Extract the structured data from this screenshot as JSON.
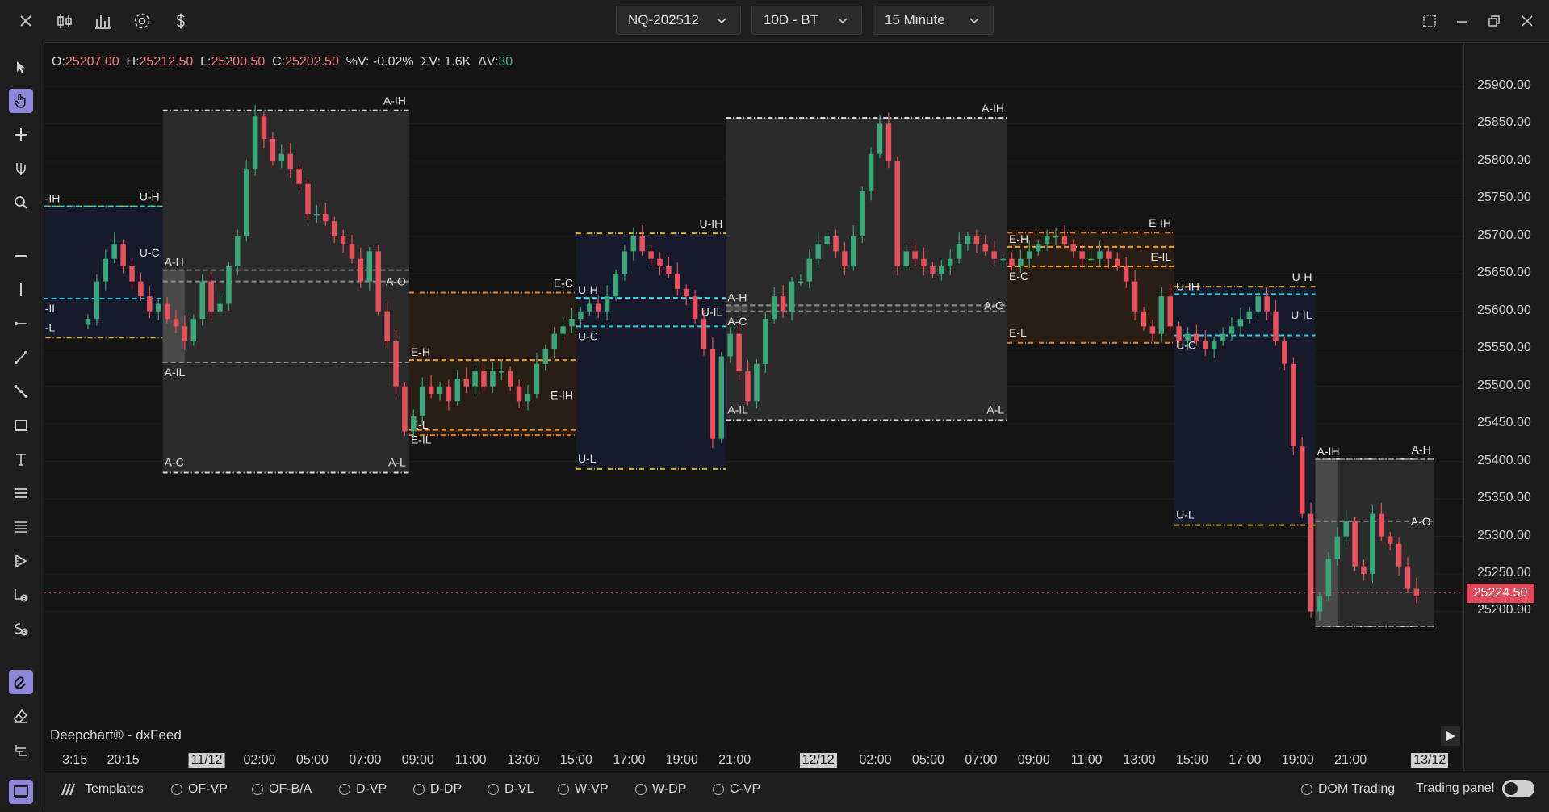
{
  "toolbar": {
    "symbol": "NQ-202512",
    "range": "10D - BT",
    "interval": "15 Minute",
    "icons": [
      "close-icon",
      "candlestick-icon",
      "bar-chart-icon",
      "settings-icon",
      "dollar-icon",
      "maximize-icon",
      "minimize-icon",
      "restore-icon",
      "window-close-icon"
    ]
  },
  "left_tools": [
    "cursor-arrow-icon",
    "hand-pointer-icon",
    "crosshair-icon",
    "fork-pointer-icon",
    "zoom-icon",
    "horizontal-line-icon",
    "vertical-line-icon",
    "ray-icon",
    "trend-line-icon",
    "path-icon",
    "rectangle-icon",
    "text-icon",
    "lines-icon",
    "multi-lines-icon",
    "ruler-icon",
    "price-buy-icon",
    "price-sell-icon",
    "magnet-icon",
    "eraser-icon",
    "layers-icon",
    "panel-icon"
  ],
  "ohlc": {
    "o_label": "O:",
    "o": "25207.00",
    "h_label": "H:",
    "h": "25212.50",
    "l_label": "L:",
    "l": "25200.50",
    "c_label": "C:",
    "c": "25202.50",
    "pv": "%V: -0.02%",
    "sv": "ΣV: 1.6K",
    "dv_label": "ΔV:",
    "dv": "30"
  },
  "watermark": "Deepchart® - dxFeed",
  "current_price": "25224.50",
  "bottom": {
    "templates": "Templates",
    "radios": [
      "OF-VP",
      "OF-B/A",
      "D-VP",
      "D-DP",
      "D-VL",
      "W-VP",
      "W-DP",
      "C-VP"
    ],
    "dom_trading": "DOM Trading",
    "trading_panel": "Trading panel"
  },
  "colors": {
    "up": "#3aa67b",
    "down": "#e8505b",
    "asia": "#d8d8d8",
    "europe": "#f4a020",
    "us": "#27d3e8",
    "session_y": "#d8b32e"
  },
  "chart_data": {
    "type": "candlestick",
    "ylim": [
      25180,
      25930
    ],
    "y_ticks": [
      25900,
      25850,
      25800,
      25750,
      25700,
      25650,
      25600,
      25550,
      25500,
      25450,
      25400,
      25350,
      25300,
      25250,
      25200
    ],
    "y_tick_labels": [
      "25900.00",
      "25850.00",
      "25800.00",
      "25750.00",
      "25700.00",
      "25650.00",
      "25600.00",
      "25550.00",
      "25500.00",
      "25450.00",
      "25400.00",
      "25350.00",
      "25300.00",
      "25250.00",
      "25200.00"
    ],
    "x_ticks": [
      {
        "label": "3:15",
        "xi": -1.5
      },
      {
        "label": "20:15",
        "xi": 4
      },
      {
        "label": "11/12",
        "xi": 13.5,
        "hl": true
      },
      {
        "label": "02:00",
        "xi": 19.5
      },
      {
        "label": "05:00",
        "xi": 25.5
      },
      {
        "label": "07:00",
        "xi": 31.5
      },
      {
        "label": "09:00",
        "xi": 37.5
      },
      {
        "label": "11:00",
        "xi": 43.5
      },
      {
        "label": "13:00",
        "xi": 49.5
      },
      {
        "label": "15:00",
        "xi": 55.5
      },
      {
        "label": "17:00",
        "xi": 61.5
      },
      {
        "label": "19:00",
        "xi": 67.5
      },
      {
        "label": "21:00",
        "xi": 73.5
      },
      {
        "label": "12/12",
        "xi": 83,
        "hl": true
      },
      {
        "label": "02:00",
        "xi": 89.5
      },
      {
        "label": "05:00",
        "xi": 95.5
      },
      {
        "label": "07:00",
        "xi": 101.5
      },
      {
        "label": "09:00",
        "xi": 107.5
      },
      {
        "label": "11:00",
        "xi": 113.5
      },
      {
        "label": "13:00",
        "xi": 119.5
      },
      {
        "label": "15:00",
        "xi": 125.5
      },
      {
        "label": "17:00",
        "xi": 131.5
      },
      {
        "label": "19:00",
        "xi": 137.5
      },
      {
        "label": "21:00",
        "xi": 143.5
      },
      {
        "label": "13/12",
        "xi": 152.5,
        "hl": true
      }
    ],
    "close": [
      25590,
      25640,
      25670,
      25690,
      25660,
      25640,
      25620,
      25600,
      25610,
      25590,
      25580,
      25560,
      25590,
      25640,
      25600,
      25610,
      25660,
      25700,
      25790,
      25860,
      25830,
      25800,
      25810,
      25790,
      25770,
      25730,
      25730,
      25720,
      25700,
      25690,
      25670,
      25640,
      25680,
      25600,
      25560,
      25500,
      25440,
      25460,
      25500,
      25490,
      25500,
      25480,
      25510,
      25500,
      25520,
      25500,
      25520,
      25520,
      25500,
      25480,
      25490,
      25530,
      25550,
      25570,
      25580,
      25590,
      25600,
      25610,
      25600,
      25620,
      25650,
      25680,
      25700,
      25680,
      25670,
      25660,
      25650,
      25630,
      25620,
      25590,
      25550,
      25430,
      25540,
      25570,
      25520,
      25480,
      25530,
      25590,
      25620,
      25600,
      25640,
      25640,
      25670,
      25690,
      25700,
      25680,
      25660,
      25700,
      25760,
      25810,
      25850,
      25800,
      25660,
      25680,
      25670,
      25660,
      25650,
      25660,
      25670,
      25690,
      25700,
      25690,
      25680,
      25670,
      25670,
      25660,
      25670,
      25680,
      25690,
      25700,
      25700,
      25690,
      25680,
      25670,
      25670,
      25680,
      25670,
      25660,
      25640,
      25600,
      25580,
      25570,
      25620,
      25580,
      25560,
      25570,
      25560,
      25550,
      25560,
      25570,
      25580,
      25590,
      25600,
      25620,
      25600,
      25560,
      25530,
      25420,
      25330,
      25200,
      25220,
      25270,
      25300,
      25320,
      25260,
      25250,
      25330,
      25300,
      25290,
      25260,
      25230,
      25220
    ],
    "sessions": [
      {
        "type": "US",
        "x0": -6,
        "x1": 8.5,
        "high": 25740,
        "low": 25565,
        "ih": 25740,
        "il": 25617,
        "labels": [
          "U-IH",
          "U-H",
          "U-C",
          "U-IL",
          "U-L"
        ]
      },
      {
        "type": "Asia",
        "x0": 8.5,
        "x1": 36.5,
        "high": 25868,
        "low": 25385,
        "ib_x1": 11,
        "ih": 25655,
        "il": 25532,
        "open": 25640,
        "labels": [
          "A-H",
          "A-IH",
          "A-O",
          "A-IL",
          "A-C",
          "A-L"
        ]
      },
      {
        "type": "Europe",
        "x0": 36.5,
        "x1": 55.5,
        "high": 25625,
        "low": 25435,
        "ih": 25535,
        "il": 25442,
        "labels": [
          "E-H",
          "E-C",
          "E-IH",
          "E-IL",
          "E-L"
        ]
      },
      {
        "type": "US",
        "x0": 55.5,
        "x1": 72.5,
        "high": 25704,
        "low": 25390,
        "ih": 25618,
        "il": 25580,
        "labels": [
          "U-H",
          "U-IH",
          "U-IL",
          "U-C",
          "U-L"
        ]
      },
      {
        "type": "Asia",
        "x0": 72.5,
        "x1": 104.5,
        "high": 25858,
        "low": 25455,
        "ib_x1": 75,
        "ih": 25608,
        "il": 25600,
        "open": 25608,
        "labels": [
          "A-H",
          "A-IH",
          "A-O",
          "A-C",
          "A-IL",
          "A-L"
        ]
      },
      {
        "type": "Europe",
        "x0": 104.5,
        "x1": 123.5,
        "high": 25705,
        "low": 25558,
        "ih": 25686,
        "il": 25660,
        "labels": [
          "E-H",
          "E-IH",
          "E-IL",
          "E-C",
          "E-L"
        ]
      },
      {
        "type": "US",
        "x0": 123.5,
        "x1": 139.5,
        "high": 25633,
        "low": 25315,
        "ih": 25623,
        "il": 25568,
        "labels": [
          "U-IH",
          "U-H",
          "U-IL",
          "U-C",
          "U-L"
        ]
      },
      {
        "type": "Asia",
        "x0": 139.5,
        "x1": 153,
        "high": 25403,
        "low": 25180,
        "ib_x1": 142,
        "ih": 25403,
        "il": 25180,
        "open": 25320,
        "labels": [
          "A-IH",
          "A-H",
          "A-O"
        ]
      }
    ]
  }
}
